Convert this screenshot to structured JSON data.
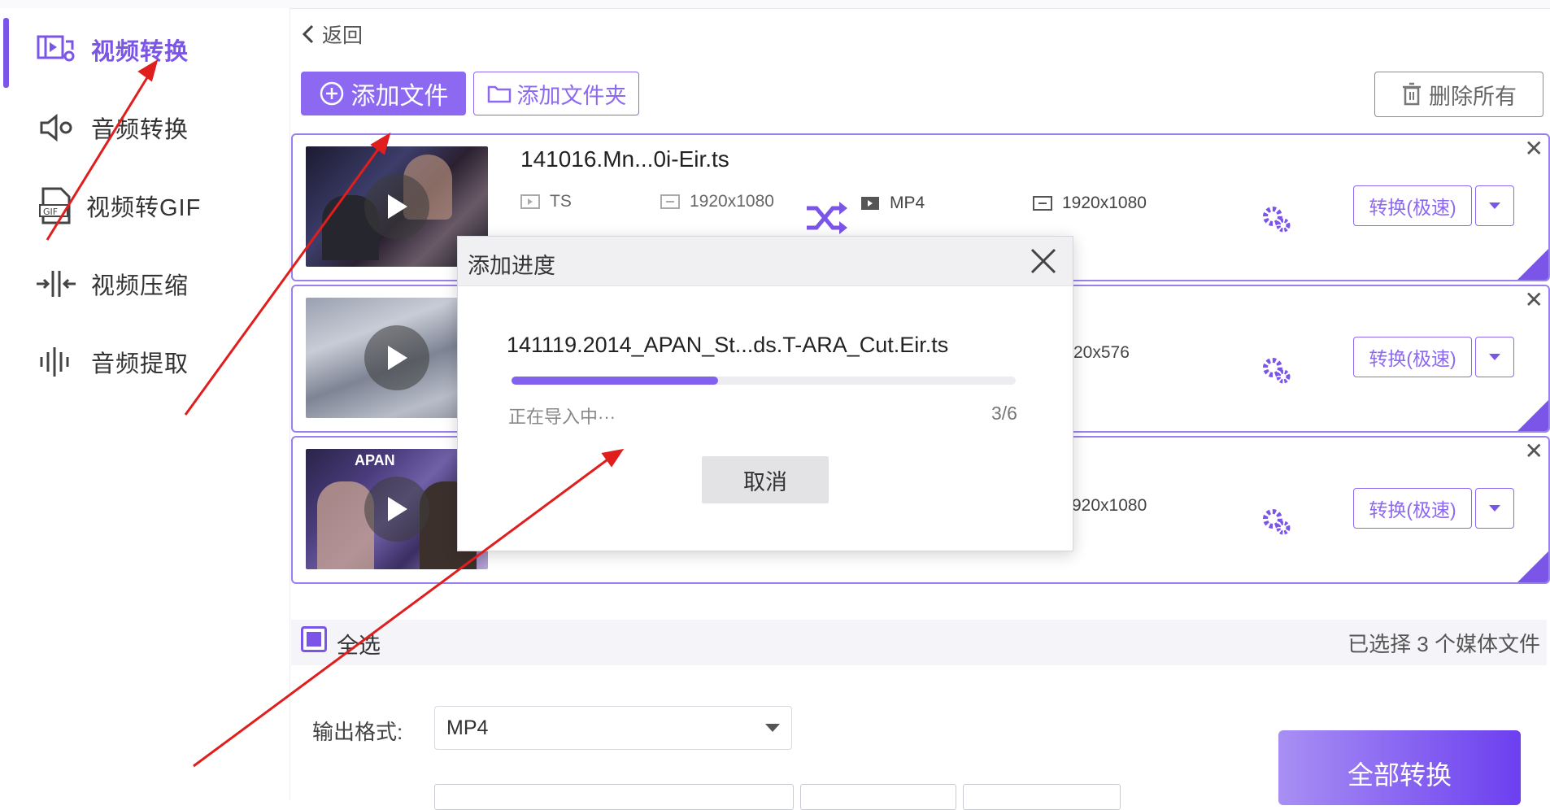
{
  "sidebar": {
    "items": [
      {
        "label": "视频转换",
        "icon": "video-convert-icon",
        "active": true
      },
      {
        "label": "音频转换",
        "icon": "audio-convert-icon",
        "active": false
      },
      {
        "label": "视频转GIF",
        "icon": "gif-icon",
        "active": false
      },
      {
        "label": "视频压缩",
        "icon": "compress-icon",
        "active": false
      },
      {
        "label": "音频提取",
        "icon": "audio-extract-icon",
        "active": false
      }
    ]
  },
  "toolbar": {
    "back_label": "返回",
    "add_file_label": "添加文件",
    "add_folder_label": "添加文件夹",
    "delete_all_label": "删除所有"
  },
  "files": [
    {
      "name": "141016.Mn...0i-Eir.ts",
      "src_format": "TS",
      "src_resolution": "1920x1080",
      "dst_format": "MP4",
      "dst_resolution": "1920x1080",
      "convert_label": "转换(极速)"
    },
    {
      "dst_resolution_partial": "20x576",
      "convert_label": "转换(极速)"
    },
    {
      "dst_resolution_partial": "920x1080",
      "convert_label": "转换(极速)"
    }
  ],
  "footer": {
    "select_all_label": "全选",
    "selected_count": "已选择 3 个媒体文件",
    "output_format_label": "输出格式:",
    "output_format_value": "MP4",
    "convert_all_label": "全部转换"
  },
  "modal": {
    "title": "添加进度",
    "file_name": "141119.2014_APAN_St...ds.T-ARA_Cut.Eir.ts",
    "progress": 0.41,
    "status": "正在导入中···",
    "count": "3/6",
    "cancel_label": "取消"
  },
  "colors": {
    "accent": "#7b55e8",
    "annotation_arrow": "#e01e1e"
  }
}
